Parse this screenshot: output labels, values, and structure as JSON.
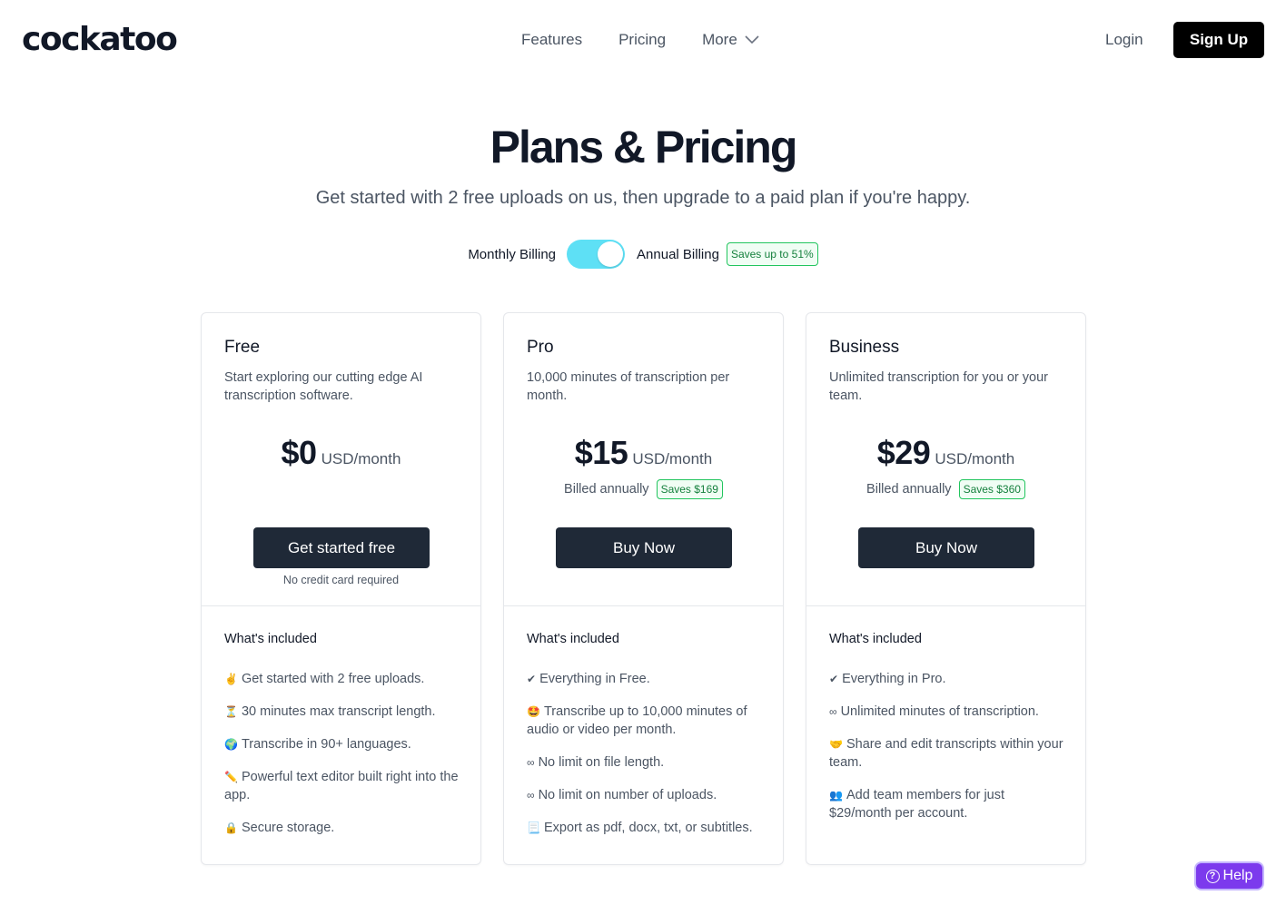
{
  "header": {
    "logo": "cockatoo",
    "nav": [
      "Features",
      "Pricing"
    ],
    "more_label": "More",
    "login": "Login",
    "signup": "Sign Up"
  },
  "hero": {
    "title": "Plans & Pricing",
    "subtitle": "Get started with 2 free uploads on us, then upgrade to a paid plan if you're happy."
  },
  "billing": {
    "monthly": "Monthly Billing",
    "annual": "Annual Billing",
    "annual_selected": true,
    "save_badge": "Saves up to 51%"
  },
  "plans": [
    {
      "name": "Free",
      "description": "Start exploring our cutting edge AI transcription software.",
      "price": "$0",
      "unit": "USD/month",
      "billed": "",
      "saves": "",
      "cta": "Get started free",
      "note": "No credit card required",
      "included_title": "What's included",
      "features": [
        {
          "icon": "✌️",
          "text": "Get started with 2 free uploads."
        },
        {
          "icon": "⏳",
          "text": "30 minutes max transcript length."
        },
        {
          "icon": "🌍",
          "text": "Transcribe in 90+ languages."
        },
        {
          "icon": "✏️",
          "text": "Powerful text editor built right into the app."
        },
        {
          "icon": "🔒",
          "text": "Secure storage."
        }
      ]
    },
    {
      "name": "Pro",
      "description": "10,000 minutes of transcription per month.",
      "price": "$15",
      "unit": "USD/month",
      "billed": "Billed annually",
      "saves": "Saves $169",
      "cta": "Buy Now",
      "note": "",
      "included_title": "What's included",
      "features": [
        {
          "icon": "✔",
          "text": "Everything in Free."
        },
        {
          "icon": "🤩",
          "text": "Transcribe up to 10,000 minutes of audio or video per month."
        },
        {
          "icon": "∞",
          "text": "No limit on file length."
        },
        {
          "icon": "∞",
          "text": "No limit on number of uploads."
        },
        {
          "icon": "📃",
          "text": "Export as pdf, docx, txt, or subtitles."
        }
      ]
    },
    {
      "name": "Business",
      "description": "Unlimited transcription for you or your team.",
      "price": "$29",
      "unit": "USD/month",
      "billed": "Billed annually",
      "saves": "Saves $360",
      "cta": "Buy Now",
      "note": "",
      "included_title": "What's included",
      "features": [
        {
          "icon": "✔",
          "text": "Everything in Pro."
        },
        {
          "icon": "∞",
          "text": "Unlimited minutes of transcription."
        },
        {
          "icon": "🤝",
          "text": "Share and edit transcripts within your team."
        },
        {
          "icon": "👥",
          "text": "Add team members for just $29/month per account."
        }
      ]
    }
  ],
  "help": {
    "icon": "?",
    "label": "Help"
  },
  "colors": {
    "toggle": "#5ee0f5",
    "cta": "#1f2937",
    "badge": "#22c55e",
    "help": "#7c3aed"
  }
}
